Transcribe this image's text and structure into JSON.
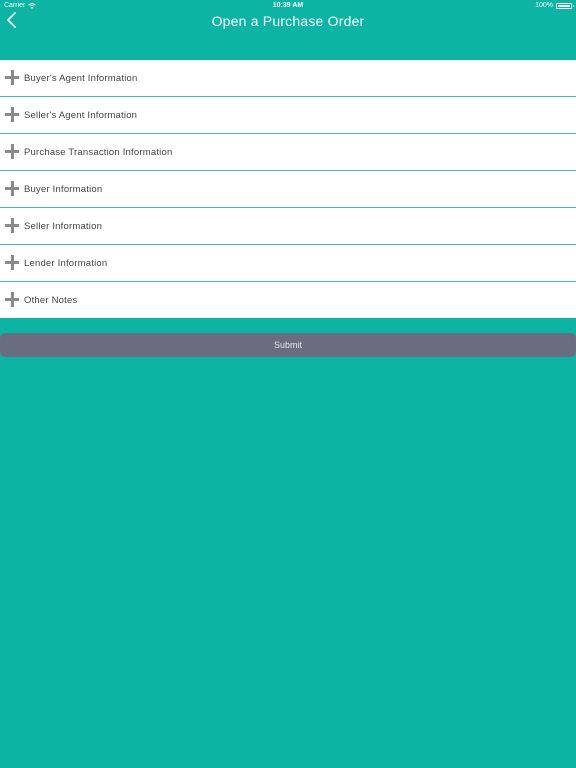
{
  "status_bar": {
    "carrier": "Carrier",
    "time": "10:39 AM",
    "battery": "100%"
  },
  "nav": {
    "title": "Open a Purchase Order",
    "back_icon": "chevron-left-icon"
  },
  "sections": [
    {
      "label": "Buyer's Agent Information"
    },
    {
      "label": "Seller's Agent Information"
    },
    {
      "label": "Purchase Transaction Information"
    },
    {
      "label": "Buyer Information"
    },
    {
      "label": "Seller Information"
    },
    {
      "label": "Lender Information"
    },
    {
      "label": "Other Notes"
    }
  ],
  "submit": {
    "label": "Submit"
  },
  "colors": {
    "background": "#0bb4a3",
    "submit": "#6b6c7f",
    "divider": "#3cc0b3",
    "plus": "#8a8a8a"
  }
}
